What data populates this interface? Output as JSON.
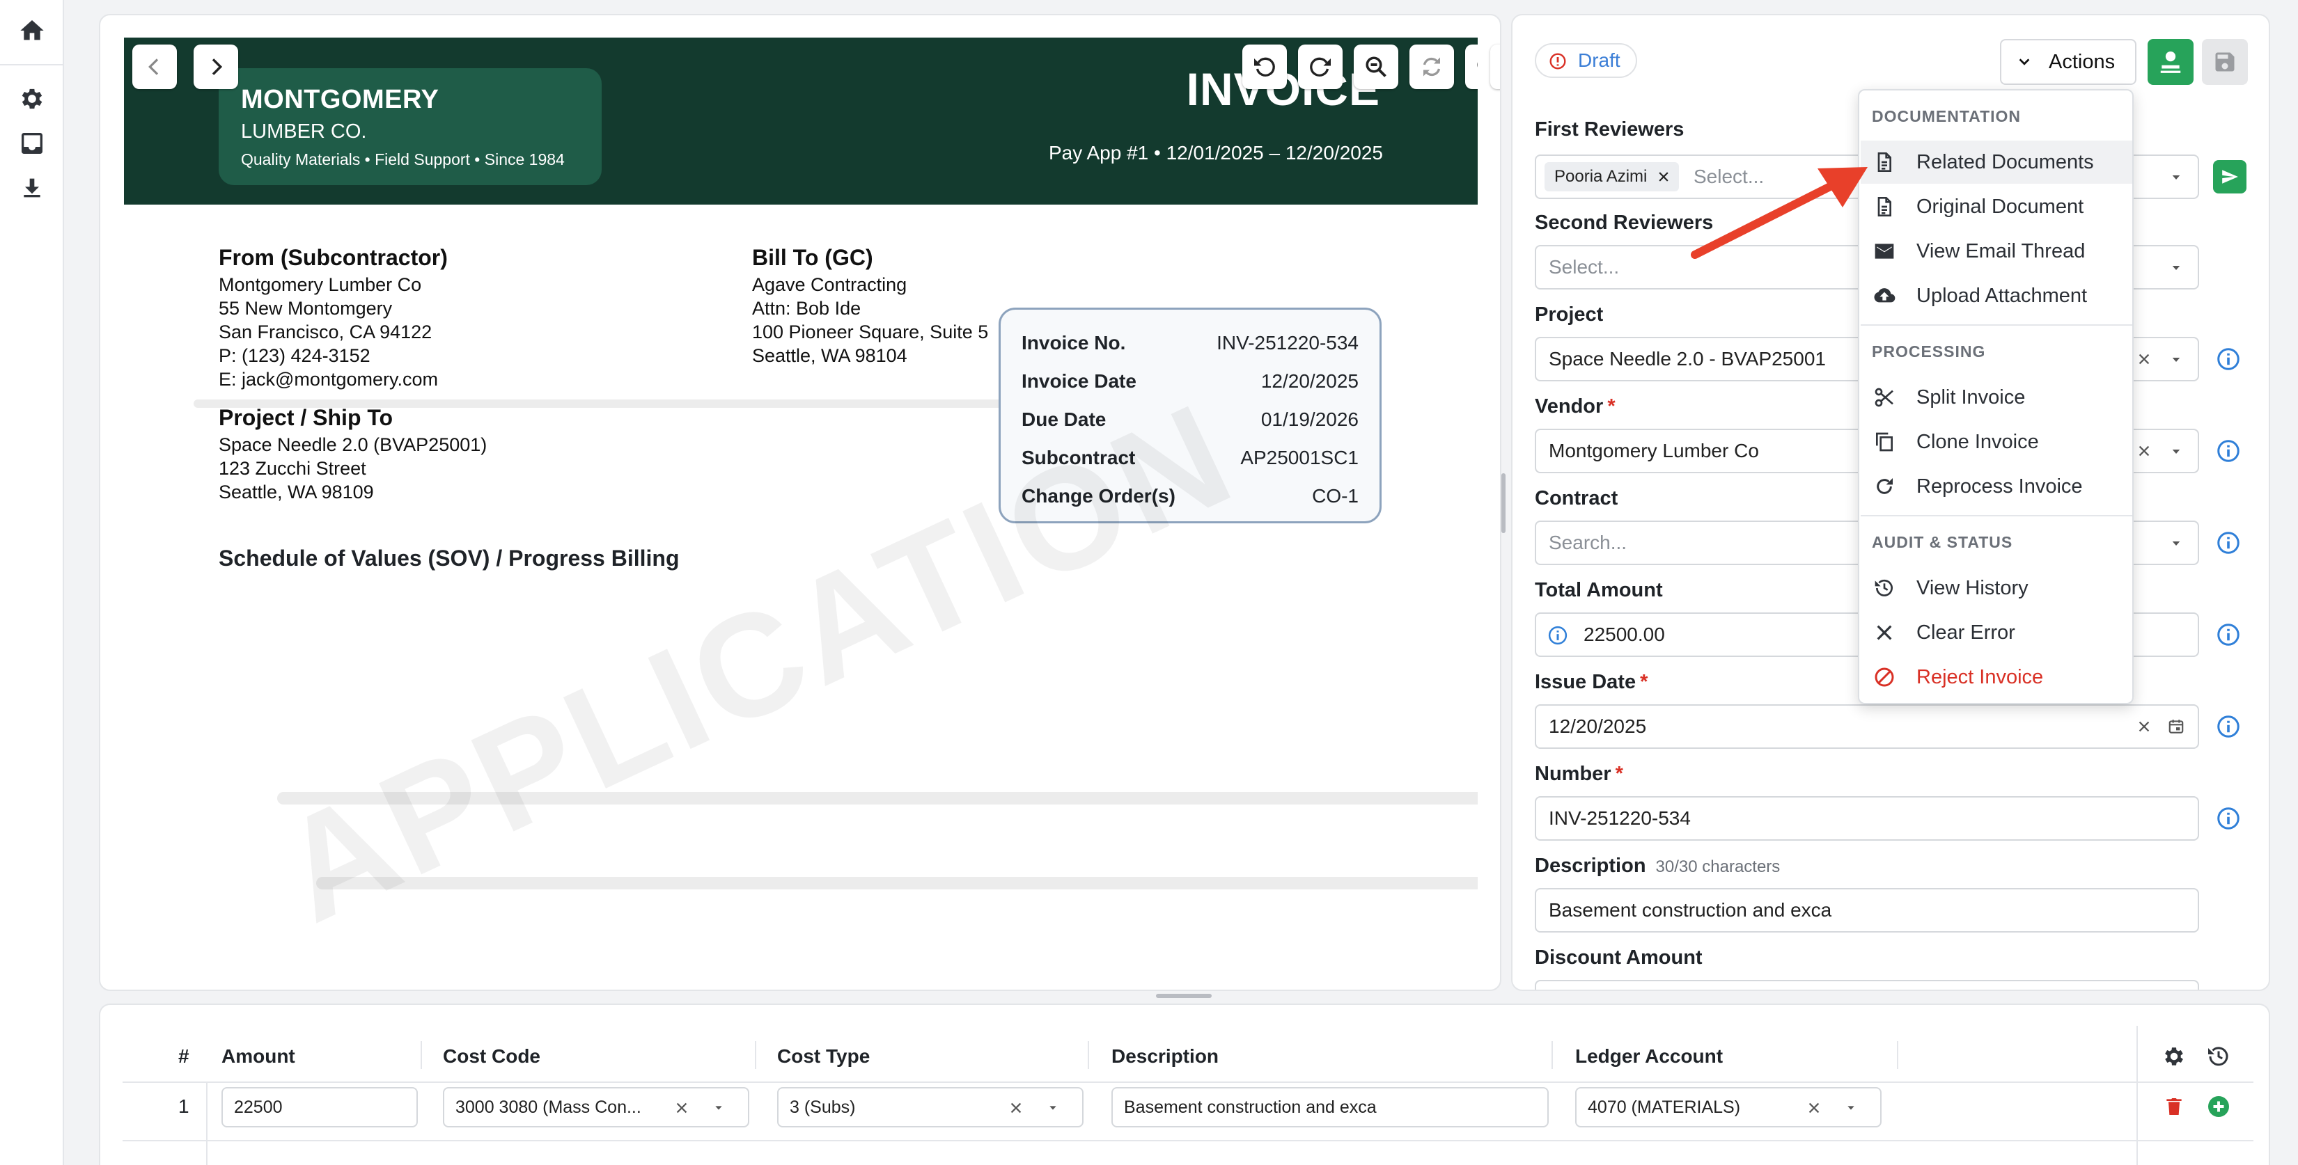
{
  "rail": {
    "icons": [
      "home-icon",
      "gear-icon",
      "inbox-icon",
      "download-icon"
    ]
  },
  "document": {
    "vendor_name": "MONTGOMERY",
    "vendor_sub": "LUMBER CO.",
    "vendor_tagline": "Quality Materials • Field Support • Since 1984",
    "title": "INVOICE",
    "pay_app": "Pay App #1 • 12/01/2025 – 12/20/2025",
    "from": {
      "heading": "From (Subcontractor)",
      "lines": [
        "Montgomery Lumber Co",
        "55 New Montomgery",
        "San Francisco, CA 94122",
        "P: (123) 424-3152",
        "E: jack@montgomery.com"
      ]
    },
    "bill_to": {
      "heading": "Bill To (GC)",
      "lines": [
        "Agave Contracting",
        "Attn: Bob Ide",
        "100 Pioneer Square, Suite 5",
        "Seattle, WA 98104"
      ]
    },
    "project": {
      "heading": "Project / Ship To",
      "lines": [
        "Space Needle 2.0 (BVAP25001)",
        "123 Zucchi Street",
        "Seattle, WA 98109"
      ]
    },
    "info": [
      {
        "k": "Invoice No.",
        "v": "INV-251220-534"
      },
      {
        "k": "Invoice Date",
        "v": "12/20/2025"
      },
      {
        "k": "Due Date",
        "v": "01/19/2026"
      },
      {
        "k": "Subcontract",
        "v": "AP25001SC1"
      },
      {
        "k": "Change Order(s)",
        "v": "CO-1"
      }
    ],
    "sov_title": "Schedule of Values (SOV) / Progress Billing",
    "watermark": "APPLICATION"
  },
  "form": {
    "status": "Draft",
    "actions_label": "Actions",
    "first_reviewers": {
      "label": "First Reviewers",
      "chip": "Pooria Azimi",
      "placeholder": "Select..."
    },
    "second_reviewers": {
      "label": "Second Reviewers",
      "placeholder": "Select..."
    },
    "project": {
      "label": "Project",
      "value": "Space Needle 2.0 - BVAP25001"
    },
    "vendor": {
      "label": "Vendor",
      "req": "*",
      "value": "Montgomery Lumber Co"
    },
    "contract": {
      "label": "Contract",
      "placeholder": "Search..."
    },
    "total_amount": {
      "label": "Total Amount",
      "value": "22500.00"
    },
    "issue_date": {
      "label": "Issue Date",
      "req": "*",
      "value": "12/20/2025"
    },
    "number": {
      "label": "Number",
      "req": "*",
      "value": "INV-251220-534"
    },
    "description": {
      "label": "Description",
      "sub": "30/30 characters",
      "value": "Basement construction and exca"
    },
    "discount_amount": {
      "label": "Discount Amount"
    }
  },
  "menu": {
    "sections": [
      {
        "title": "DOCUMENTATION",
        "items": [
          {
            "label": "Related Documents",
            "icon": "document-icon"
          },
          {
            "label": "Original Document",
            "icon": "document-icon"
          },
          {
            "label": "View Email Thread",
            "icon": "email-icon"
          },
          {
            "label": "Upload Attachment",
            "icon": "cloud-upload-icon"
          }
        ]
      },
      {
        "title": "PROCESSING",
        "items": [
          {
            "label": "Split Invoice",
            "icon": "scissors-icon"
          },
          {
            "label": "Clone Invoice",
            "icon": "copy-icon"
          },
          {
            "label": "Reprocess Invoice",
            "icon": "refresh-icon"
          }
        ]
      },
      {
        "title": "AUDIT & STATUS",
        "items": [
          {
            "label": "View History",
            "icon": "history-icon"
          },
          {
            "label": "Clear Error",
            "icon": "close-icon"
          },
          {
            "label": "Reject Invoice",
            "icon": "block-icon"
          }
        ]
      }
    ]
  },
  "lines_table": {
    "headers": {
      "num": "#",
      "amount": "Amount",
      "cost_code": "Cost Code",
      "cost_type": "Cost Type",
      "description": "Description",
      "ledger": "Ledger Account"
    },
    "rows": [
      {
        "num": "1",
        "amount": "22500",
        "cost_code": "3000 3080 (Mass Con...",
        "cost_type": "3 (Subs)",
        "description": "Basement construction and exca",
        "ledger": "4070 (MATERIALS)"
      }
    ]
  },
  "colors": {
    "brand_dark": "#133a2e",
    "brand_card": "#1f5c48",
    "success": "#27a35a",
    "danger": "#d93025",
    "info": "#2f7fd8",
    "annotation_arrow": "#e8402a"
  }
}
